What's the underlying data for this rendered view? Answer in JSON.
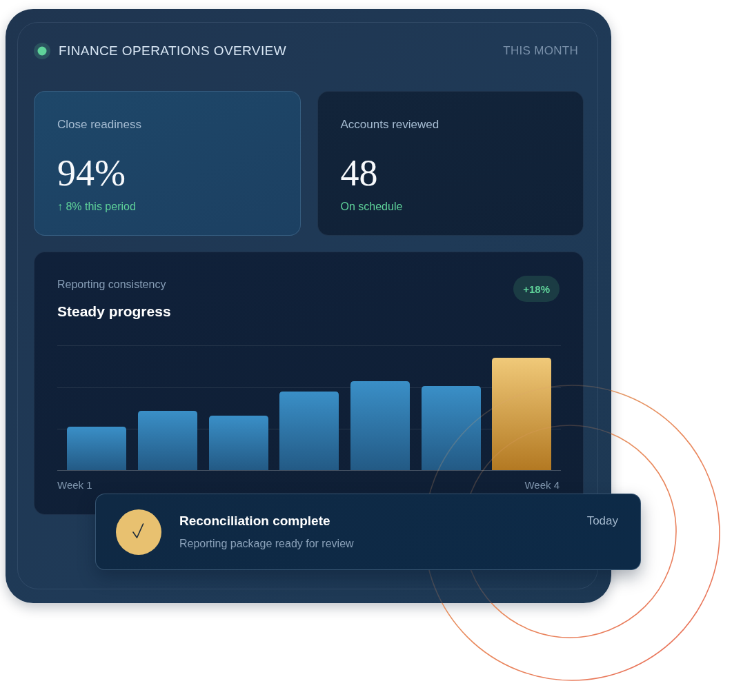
{
  "header": {
    "title": "FINANCE OPERATIONS OVERVIEW",
    "period": "THIS MONTH"
  },
  "metrics": [
    {
      "label": "Close readiness",
      "value": "94%",
      "change": "↑ 8% this period",
      "highlighted": true
    },
    {
      "label": "Accounts reviewed",
      "value": "48",
      "change": "On schedule",
      "highlighted": false
    }
  ],
  "chart": {
    "label": "Reporting consistency",
    "title": "Steady progress",
    "badge": "+18%",
    "x_labels": [
      "Week 1",
      "Week 4"
    ]
  },
  "notification": {
    "title": "Reconciliation complete",
    "message": "Reporting package ready for review",
    "time": "Today"
  }
}
